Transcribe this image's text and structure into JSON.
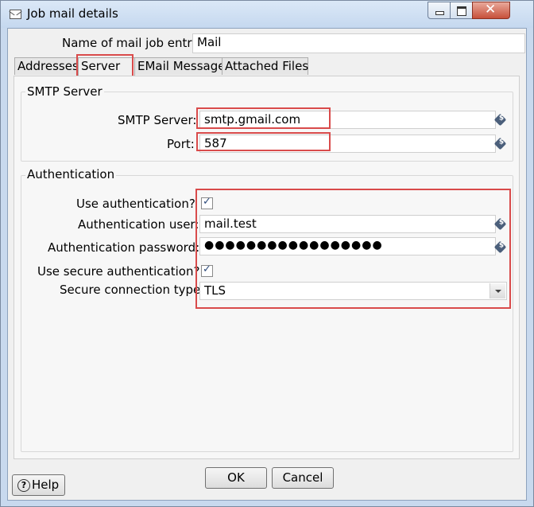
{
  "window": {
    "title": "Job mail details"
  },
  "name_field": {
    "label": "Name of mail job entry:",
    "value": "Mail"
  },
  "tabs": [
    {
      "label": "Addresses",
      "active": false
    },
    {
      "label": "Server",
      "active": true
    },
    {
      "label": "EMail Message",
      "active": false
    },
    {
      "label": "Attached Files",
      "active": false
    }
  ],
  "smtp_group": {
    "title": "SMTP Server",
    "server_label": "SMTP Server:",
    "server_value": "smtp.gmail.com",
    "port_label": "Port:",
    "port_value": "587"
  },
  "auth_group": {
    "title": "Authentication",
    "use_auth_label": "Use authentication?",
    "use_auth_checked": true,
    "user_label": "Authentication user:",
    "user_value": "mail.test",
    "password_label": "Authentication password:",
    "password_value": "●●●●●●●●●●●●●●●●●",
    "secure_label": "Use secure authentication?",
    "secure_checked": true,
    "conn_type_label": "Secure connection type",
    "conn_type_value": "TLS"
  },
  "footer": {
    "help_label": "Help",
    "ok_label": "OK",
    "cancel_label": "Cancel"
  },
  "colors": {
    "highlight": "#d94b4b",
    "title_bar": "#c8d9ee",
    "close_button": "#c7503a"
  },
  "icons": [
    "mail-icon",
    "minimize-icon",
    "maximize-icon",
    "close-icon",
    "variable-icon",
    "help-icon",
    "dropdown-arrow-icon"
  ]
}
